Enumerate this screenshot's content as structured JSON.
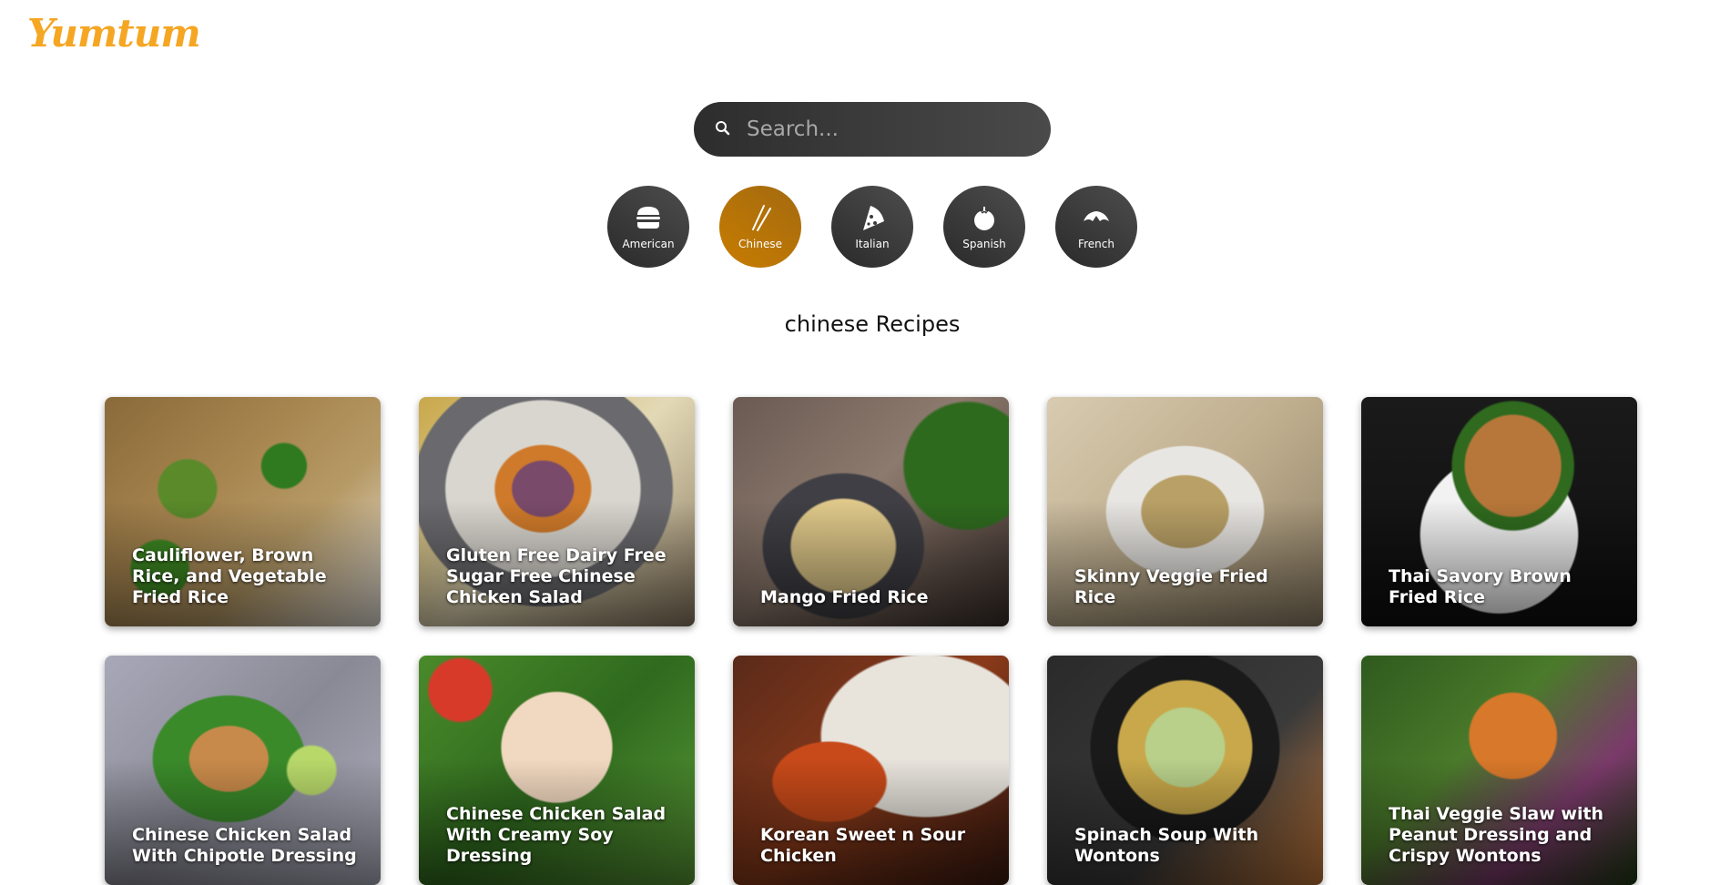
{
  "brand": {
    "logo_text": "Yumtum",
    "accent_color": "#f5a623"
  },
  "search": {
    "placeholder": "Search...",
    "value": "",
    "icon": "search-icon"
  },
  "categories": [
    {
      "label": "American",
      "icon": "burger-icon",
      "active": false
    },
    {
      "label": "Chinese",
      "icon": "chopsticks-icon",
      "active": true
    },
    {
      "label": "Italian",
      "icon": "pizza-icon",
      "active": false
    },
    {
      "label": "Spanish",
      "icon": "tomato-icon",
      "active": false
    },
    {
      "label": "French",
      "icon": "croissant-icon",
      "active": false
    }
  ],
  "section_title": "chinese Recipes",
  "recipes": [
    {
      "title": "Cauliflower, Brown Rice, and Vegetable Fried Rice"
    },
    {
      "title": "Gluten Free Dairy Free Sugar Free Chinese Chicken Salad"
    },
    {
      "title": "Mango Fried Rice"
    },
    {
      "title": "Skinny Veggie Fried Rice"
    },
    {
      "title": "Thai Savory Brown Fried Rice"
    },
    {
      "title": "Chinese Chicken Salad With Chipotle Dressing"
    },
    {
      "title": "Chinese Chicken Salad With Creamy Soy Dressing"
    },
    {
      "title": "Korean Sweet n Sour Chicken"
    },
    {
      "title": "Spinach Soup With Wontons"
    },
    {
      "title": "Thai Veggie Slaw with Peanut Dressing and Crispy Wontons"
    }
  ]
}
